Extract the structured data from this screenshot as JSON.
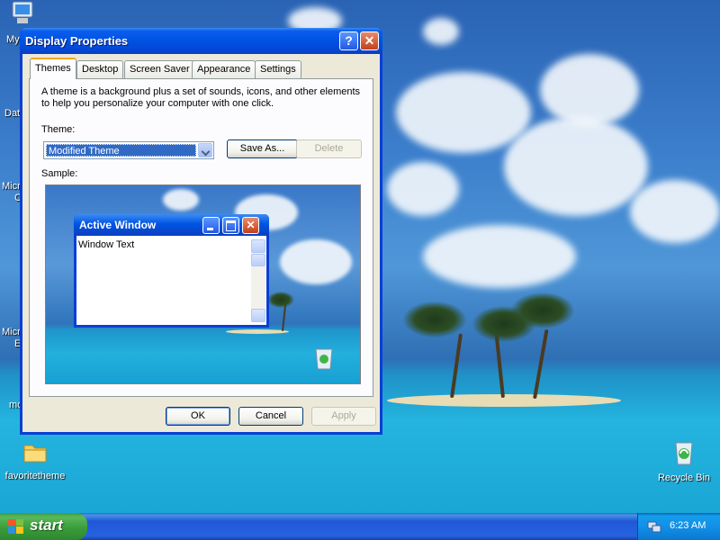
{
  "desktop": {
    "icons": [
      {
        "label": "favoritetheme"
      },
      {
        "label": "Recycle Bin"
      }
    ],
    "edge_labels": [
      "My",
      "Dat",
      "Micr",
      "C",
      "Micr",
      "E",
      "mc"
    ]
  },
  "dialog": {
    "title": "Display Properties",
    "help_label": "?",
    "close_label": "✕",
    "tabs": [
      {
        "label": "Themes"
      },
      {
        "label": "Desktop"
      },
      {
        "label": "Screen Saver"
      },
      {
        "label": "Appearance"
      },
      {
        "label": "Settings"
      }
    ],
    "description": "A theme is a background plus a set of sounds, icons, and other elements to help you personalize your computer with one click.",
    "theme_label": "Theme:",
    "theme_value": "Modified Theme",
    "save_as_label": "Save As...",
    "delete_label": "Delete",
    "sample_label": "Sample:",
    "sample": {
      "window_title": "Active Window",
      "window_text": "Window Text"
    },
    "ok_label": "OK",
    "cancel_label": "Cancel",
    "apply_label": "Apply"
  },
  "taskbar": {
    "start_label": "start",
    "clock": "6:23 AM"
  }
}
